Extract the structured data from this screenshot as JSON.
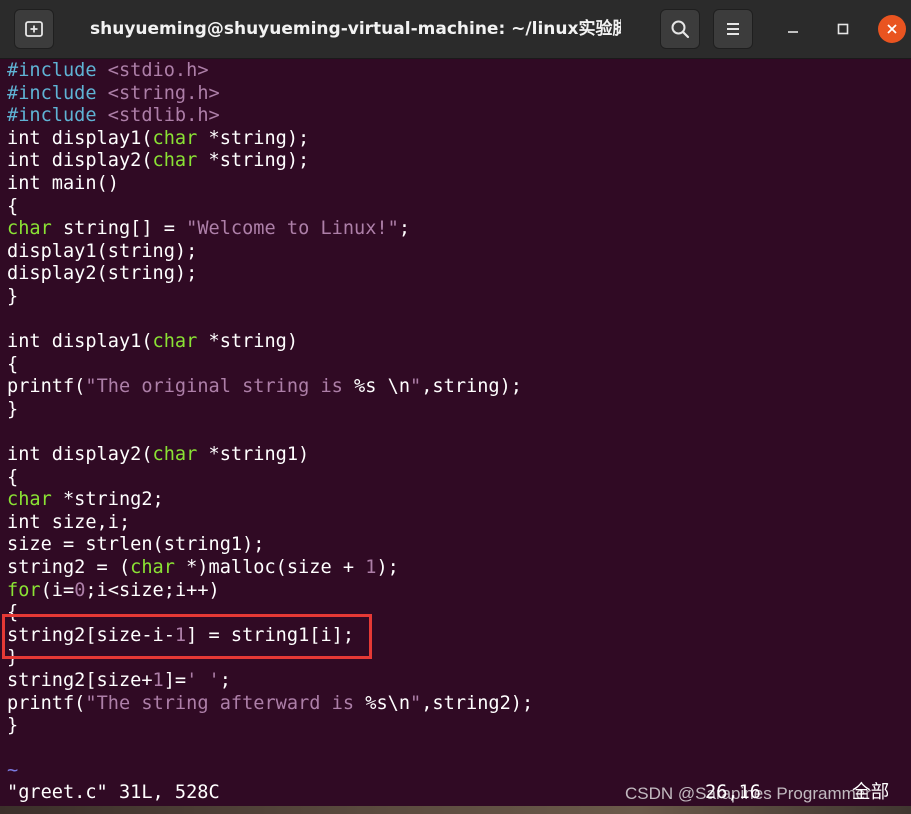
{
  "window": {
    "title": "shuyueming@shuyueming-virtual-machine: ~/linux实验脚本"
  },
  "titlebar_icons": {
    "new_tab": "new-tab-icon",
    "search": "search-icon",
    "menu": "hamburger-menu-icon",
    "minimize": "minimize-icon",
    "maximize": "maximize-icon",
    "close": "close-icon"
  },
  "colors": {
    "terminal_bg": "#300a24",
    "preprocessor": "#5fb3d4",
    "type_keyword": "#8ae234",
    "string_literal": "#ad7fa8",
    "highlight_box": "#e53935",
    "close_button": "#e95420"
  },
  "editor": {
    "lines": [
      [
        {
          "t": "#include",
          "c": "pre"
        },
        {
          "t": " "
        },
        {
          "t": "<stdio.h>",
          "c": "hdr"
        }
      ],
      [
        {
          "t": "#include",
          "c": "pre"
        },
        {
          "t": " "
        },
        {
          "t": "<string.h>",
          "c": "hdr"
        }
      ],
      [
        {
          "t": "#include",
          "c": "pre"
        },
        {
          "t": " "
        },
        {
          "t": "<stdlib.h>",
          "c": "hdr"
        }
      ],
      [
        {
          "t": "int display1("
        },
        {
          "t": "char",
          "c": "typ"
        },
        {
          "t": " *string);"
        }
      ],
      [
        {
          "t": "int display2("
        },
        {
          "t": "char",
          "c": "typ"
        },
        {
          "t": " *string);"
        }
      ],
      [
        {
          "t": "int main()"
        }
      ],
      [
        {
          "t": "{"
        }
      ],
      [
        {
          "t": "char",
          "c": "typ"
        },
        {
          "t": " string[] = "
        },
        {
          "t": "\"Welcome to Linux!\"",
          "c": "str"
        },
        {
          "t": ";"
        }
      ],
      [
        {
          "t": "display1(string);"
        }
      ],
      [
        {
          "t": "display2(string);"
        }
      ],
      [
        {
          "t": "}"
        }
      ],
      [
        {
          "t": ""
        }
      ],
      [
        {
          "t": "int display1("
        },
        {
          "t": "char",
          "c": "typ"
        },
        {
          "t": " *string)"
        }
      ],
      [
        {
          "t": "{"
        }
      ],
      [
        {
          "t": "printf("
        },
        {
          "t": "\"The original string is ",
          "c": "str"
        },
        {
          "t": "%s"
        },
        {
          "t": " "
        },
        {
          "t": "\\n"
        },
        {
          "t": "\"",
          "c": "str"
        },
        {
          "t": ",string);"
        }
      ],
      [
        {
          "t": "}"
        }
      ],
      [
        {
          "t": ""
        }
      ],
      [
        {
          "t": "int display2("
        },
        {
          "t": "char",
          "c": "typ"
        },
        {
          "t": " *string1)"
        }
      ],
      [
        {
          "t": "{"
        }
      ],
      [
        {
          "t": "char",
          "c": "typ"
        },
        {
          "t": " *string2;"
        }
      ],
      [
        {
          "t": "int size,i;"
        }
      ],
      [
        {
          "t": "size = strlen(string1);"
        }
      ],
      [
        {
          "t": "string2 = ("
        },
        {
          "t": "char",
          "c": "typ"
        },
        {
          "t": " *)malloc(size + "
        },
        {
          "t": "1",
          "c": "num"
        },
        {
          "t": ");"
        }
      ],
      [
        {
          "t": "for",
          "c": "typ"
        },
        {
          "t": "(i="
        },
        {
          "t": "0",
          "c": "num"
        },
        {
          "t": ";i<size;i++)"
        }
      ],
      [
        {
          "t": "{"
        }
      ],
      [
        {
          "t": "string2[size-i-"
        },
        {
          "t": "1",
          "c": "num"
        },
        {
          "t": "] = string1[i];"
        }
      ],
      [
        {
          "t": "}"
        }
      ],
      [
        {
          "t": "string2[size+"
        },
        {
          "t": "1",
          "c": "num"
        },
        {
          "t": "]="
        },
        {
          "t": "' '",
          "c": "str"
        },
        {
          "t": ";"
        }
      ],
      [
        {
          "t": "printf("
        },
        {
          "t": "\"The string afterward is ",
          "c": "str"
        },
        {
          "t": "%s\\n"
        },
        {
          "t": "\"",
          "c": "str"
        },
        {
          "t": ",string2);"
        }
      ],
      [
        {
          "t": "}"
        }
      ],
      [
        {
          "t": ""
        }
      ],
      [
        {
          "t": "~",
          "c": "tilde"
        }
      ]
    ]
  },
  "status": {
    "file_info": "\"greet.c\" 31L, 528C",
    "cursor": "26,16",
    "scroll": "全部"
  },
  "watermark": {
    "text": "CSDN @Sarapines Programmer"
  }
}
